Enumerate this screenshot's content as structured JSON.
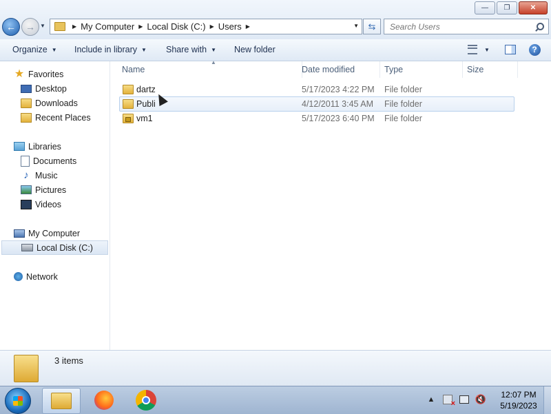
{
  "window": {
    "minimize": "—",
    "maximize": "❐",
    "close": "✕"
  },
  "nav": {
    "back": "←",
    "forward": "→"
  },
  "address": {
    "crumbs": [
      "My Computer",
      "Local Disk (C:)",
      "Users"
    ]
  },
  "search": {
    "placeholder": "Search Users"
  },
  "toolbar": {
    "organize": "Organize",
    "include_in_library": "Include in library",
    "share_with": "Share with",
    "new_folder": "New folder",
    "help": "?"
  },
  "sidebar": {
    "favorites": "Favorites",
    "favorites_items": [
      "Desktop",
      "Downloads",
      "Recent Places"
    ],
    "libraries": "Libraries",
    "libraries_items": [
      "Documents",
      "Music",
      "Pictures",
      "Videos"
    ],
    "my_computer": "My Computer",
    "local_disk": "Local Disk (C:)",
    "network": "Network"
  },
  "columns": {
    "name": "Name",
    "date_modified": "Date modified",
    "type": "Type",
    "size": "Size"
  },
  "files": [
    {
      "name": "dartz",
      "date": "5/17/2023 4:22 PM",
      "type": "File folder"
    },
    {
      "name": "Publi",
      "date": "4/12/2011 3:45 AM",
      "type": "File folder"
    },
    {
      "name": "vm1",
      "date": "5/17/2023 6:40 PM",
      "type": "File folder"
    }
  ],
  "details": {
    "item_count": "3 items"
  },
  "taskbar": {
    "time": "12:07 PM",
    "date": "5/19/2023",
    "tray_up": "▲"
  },
  "colors": {
    "selection_border": "#b8d0ec",
    "accent": "#1f5fae"
  }
}
